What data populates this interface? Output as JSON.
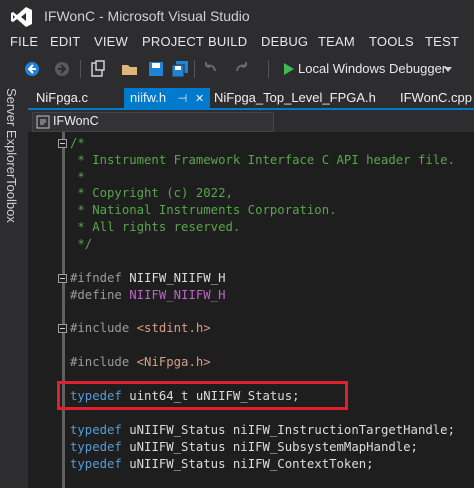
{
  "window": {
    "title": "IFWonC - Microsoft Visual Studio"
  },
  "menu": {
    "items": [
      "FILE",
      "EDIT",
      "VIEW",
      "PROJECT",
      "BUILD",
      "DEBUG",
      "TEAM",
      "TOOLS",
      "TEST"
    ]
  },
  "toolbar": {
    "debugger_label": "Local Windows Debugger",
    "icons": [
      "back-icon",
      "forward-icon",
      "new-project-icon",
      "open-file-icon",
      "save-icon",
      "save-all-icon",
      "undo-icon",
      "redo-icon",
      "start-debugging-icon",
      "dropdown-icon"
    ]
  },
  "side_panels": [
    "Server Explorer",
    "Toolbox"
  ],
  "tabs": [
    {
      "label": "NiFpga.c",
      "active": false
    },
    {
      "label": "niifw.h",
      "active": true
    },
    {
      "label": "NiFpga_Top_Level_FPGA.h",
      "active": false
    },
    {
      "label": "IFWonC.cpp",
      "active": false
    }
  ],
  "nav": {
    "project": "IFWonC"
  },
  "code": {
    "lines": [
      [
        {
          "t": "/*",
          "c": "comment"
        }
      ],
      [
        {
          "t": " * Instrument Framework Interface C API header file.",
          "c": "comment"
        }
      ],
      [
        {
          "t": " *",
          "c": "comment"
        }
      ],
      [
        {
          "t": " * Copyright (c) 2022,",
          "c": "comment"
        }
      ],
      [
        {
          "t": " * National Instruments Corporation.",
          "c": "comment"
        }
      ],
      [
        {
          "t": " * All rights reserved.",
          "c": "comment"
        }
      ],
      [
        {
          "t": " */",
          "c": "comment"
        }
      ],
      [],
      [
        {
          "t": "#ifndef ",
          "c": "prep"
        },
        {
          "t": "NIIFW_NIIFW_H",
          "c": "plain"
        }
      ],
      [
        {
          "t": "#define ",
          "c": "prep"
        },
        {
          "t": "NIIFW_NIIFW_H",
          "c": "macro"
        }
      ],
      [],
      [
        {
          "t": "#include ",
          "c": "prep"
        },
        {
          "t": "<stdint.h>",
          "c": "string"
        }
      ],
      [],
      [
        {
          "t": "#include ",
          "c": "prep"
        },
        {
          "t": "<NiFpga.h>",
          "c": "string"
        }
      ],
      [],
      [
        {
          "t": "typedef ",
          "c": "keyword"
        },
        {
          "t": "uint64_t uNIIFW_Status;",
          "c": "plain"
        }
      ],
      [],
      [
        {
          "t": "typedef ",
          "c": "keyword"
        },
        {
          "t": "uNIIFW_Status niIFW_InstructionTargetHandle;",
          "c": "plain"
        }
      ],
      [
        {
          "t": "typedef ",
          "c": "keyword"
        },
        {
          "t": "uNIIFW_Status niIFW_SubsystemMapHandle;",
          "c": "plain"
        }
      ],
      [
        {
          "t": "typedef ",
          "c": "keyword"
        },
        {
          "t": "uNIIFW_Status niIFW_ContextToken;",
          "c": "plain"
        }
      ]
    ]
  },
  "colors": {
    "accent": "#007acc",
    "highlight": "#e0202f",
    "comment": "#57a64a",
    "keyword": "#569cd6",
    "macro": "#bd63c5",
    "string": "#d69d85"
  }
}
